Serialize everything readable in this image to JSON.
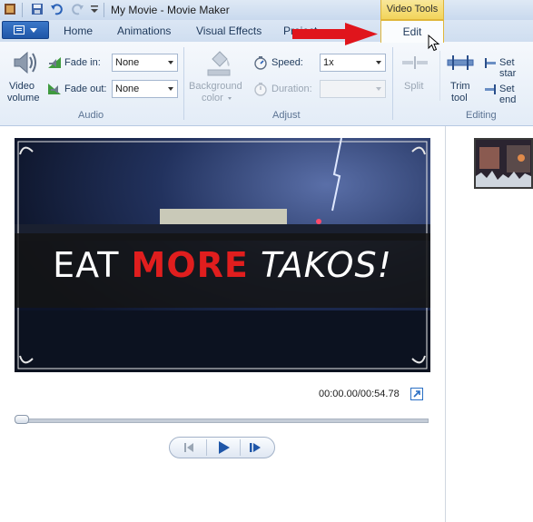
{
  "window": {
    "title": "My Movie - Movie Maker",
    "context_tab_group": "Video Tools"
  },
  "tabs": {
    "home": "Home",
    "animations": "Animations",
    "visual_effects": "Visual Effects",
    "project": "Project",
    "edit": "Edit"
  },
  "ribbon": {
    "audio": {
      "group_label": "Audio",
      "video_volume_line1": "Video",
      "video_volume_line2": "volume",
      "fade_in_label": "Fade in:",
      "fade_in_value": "None",
      "fade_out_label": "Fade out:",
      "fade_out_value": "None"
    },
    "adjust": {
      "group_label": "Adjust",
      "background_color_line1": "Background",
      "background_color_line2": "color",
      "speed_label": "Speed:",
      "speed_value": "1x",
      "duration_label": "Duration:",
      "duration_value": ""
    },
    "editing": {
      "group_label": "Editing",
      "split_label": "Split",
      "trim_tool_line1": "Trim",
      "trim_tool_line2": "tool",
      "set_start_label": "Set star",
      "set_end_label": "Set end"
    }
  },
  "preview": {
    "overlay_word1": "EAT ",
    "overlay_word2": "MORE",
    "overlay_word3": " TAKOS!",
    "timecode": "00:00.00/00:54.78",
    "seek_position_fraction": 0.0
  },
  "colors": {
    "ribbon_text": "#1e395b",
    "context_tab": "#f2d45a",
    "accent_blue": "#1f56a8",
    "overlay_red": "#e01e1e",
    "annotation_arrow": "#e0151c"
  }
}
